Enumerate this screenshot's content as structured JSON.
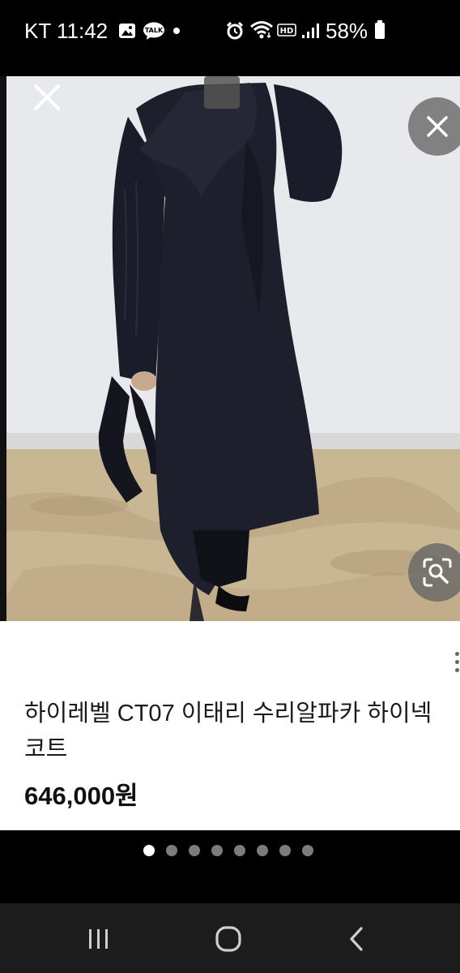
{
  "status_bar": {
    "carrier_time": "KT 11:42",
    "battery_percent": "58%",
    "icons": [
      "gallery-icon",
      "kakaotalk-icon",
      "alarm-icon",
      "wifi-icon",
      "hd-voice-icon",
      "signal-icon",
      "battery-icon"
    ],
    "talk_badge": "TALK",
    "hd_badge": "HD"
  },
  "viewer": {
    "close_icon": "close-icon",
    "close_circle_icon": "close-icon",
    "lens_icon": "visual-search-icon"
  },
  "product": {
    "title": "하이레벨 CT07 이태리 수리알파카 하이넥 코트",
    "price": "646,000원",
    "more_icon": "more-vertical-icon"
  },
  "pagination": {
    "total": 8,
    "active_index": 0
  },
  "nav_bar": {
    "icons": [
      "recent-apps-icon",
      "home-icon",
      "back-icon"
    ]
  },
  "colors": {
    "wall": "#e9eaee",
    "floor": "#c8b591",
    "coat": "#1b1d2a",
    "status_bg": "#000000",
    "nav_bg": "#1c1c1c"
  }
}
